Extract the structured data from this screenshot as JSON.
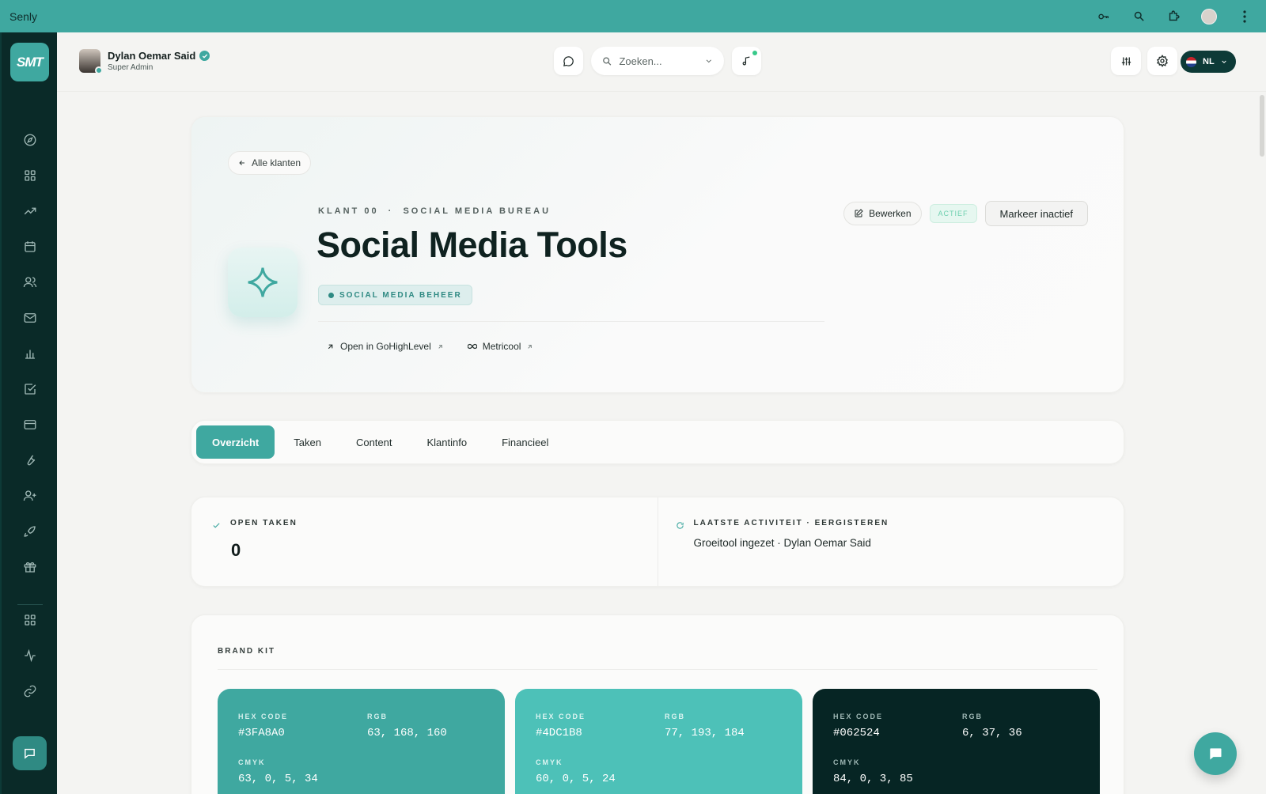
{
  "chrome": {
    "title": "Senly"
  },
  "sidebar": {
    "logo": "SMT",
    "items": [
      "compass-icon",
      "grid-icon",
      "trend-icon",
      "calendar-icon",
      "users-icon",
      "mail-icon",
      "bar-chart-icon",
      "checkbox-icon",
      "card-icon",
      "wrench-icon",
      "user-plus-icon",
      "rocket-icon",
      "gift-icon",
      "apps-icon",
      "activity-icon",
      "link-icon"
    ]
  },
  "header": {
    "user_name": "Dylan Oemar Said",
    "user_role": "Super Admin",
    "search_placeholder": "Zoeken...",
    "language": "NL"
  },
  "hero": {
    "back_label": "Alle klanten",
    "eyebrow": "KLANT 00  ·  SOCIAL MEDIA BUREAU",
    "title": "Social Media Tools",
    "tag": "SOCIAL MEDIA BEHEER",
    "link_ghl": "Open in GoHighLevel",
    "link_metricool": "Metricool",
    "edit_label": "Bewerken",
    "status": "ACTIEF",
    "mark_inactive": "Markeer inactief"
  },
  "tabs": [
    {
      "label": "Overzicht",
      "active": true
    },
    {
      "label": "Taken"
    },
    {
      "label": "Content"
    },
    {
      "label": "Klantinfo"
    },
    {
      "label": "Financieel"
    }
  ],
  "stats": {
    "open_tasks_label": "OPEN TAKEN",
    "open_tasks_value": "0",
    "activity_label": "LAATSTE ACTIVITEIT · EERGISTEREN",
    "activity_text": "Groeitool ingezet · Dylan Oemar Said"
  },
  "brand_kit": {
    "title": "BRAND KIT",
    "labels": {
      "hex": "HEX CODE",
      "rgb": "RGB",
      "cmyk": "CMYK"
    },
    "swatches": [
      {
        "hex": "#3FA8A0",
        "rgb": "63, 168, 160",
        "cmyk": "63, 0, 5, 34",
        "color": "#3fa8a0"
      },
      {
        "hex": "#4DC1B8",
        "rgb": "77, 193, 184",
        "cmyk": "60, 0, 5, 24",
        "color": "#4dc1b8"
      },
      {
        "hex": "#062524",
        "rgb": "6, 37, 36",
        "cmyk": "84, 0, 3, 85",
        "color": "#062524"
      }
    ]
  },
  "colors": {
    "accent": "#3fa8a0",
    "sidebar": "#0a2a28"
  }
}
